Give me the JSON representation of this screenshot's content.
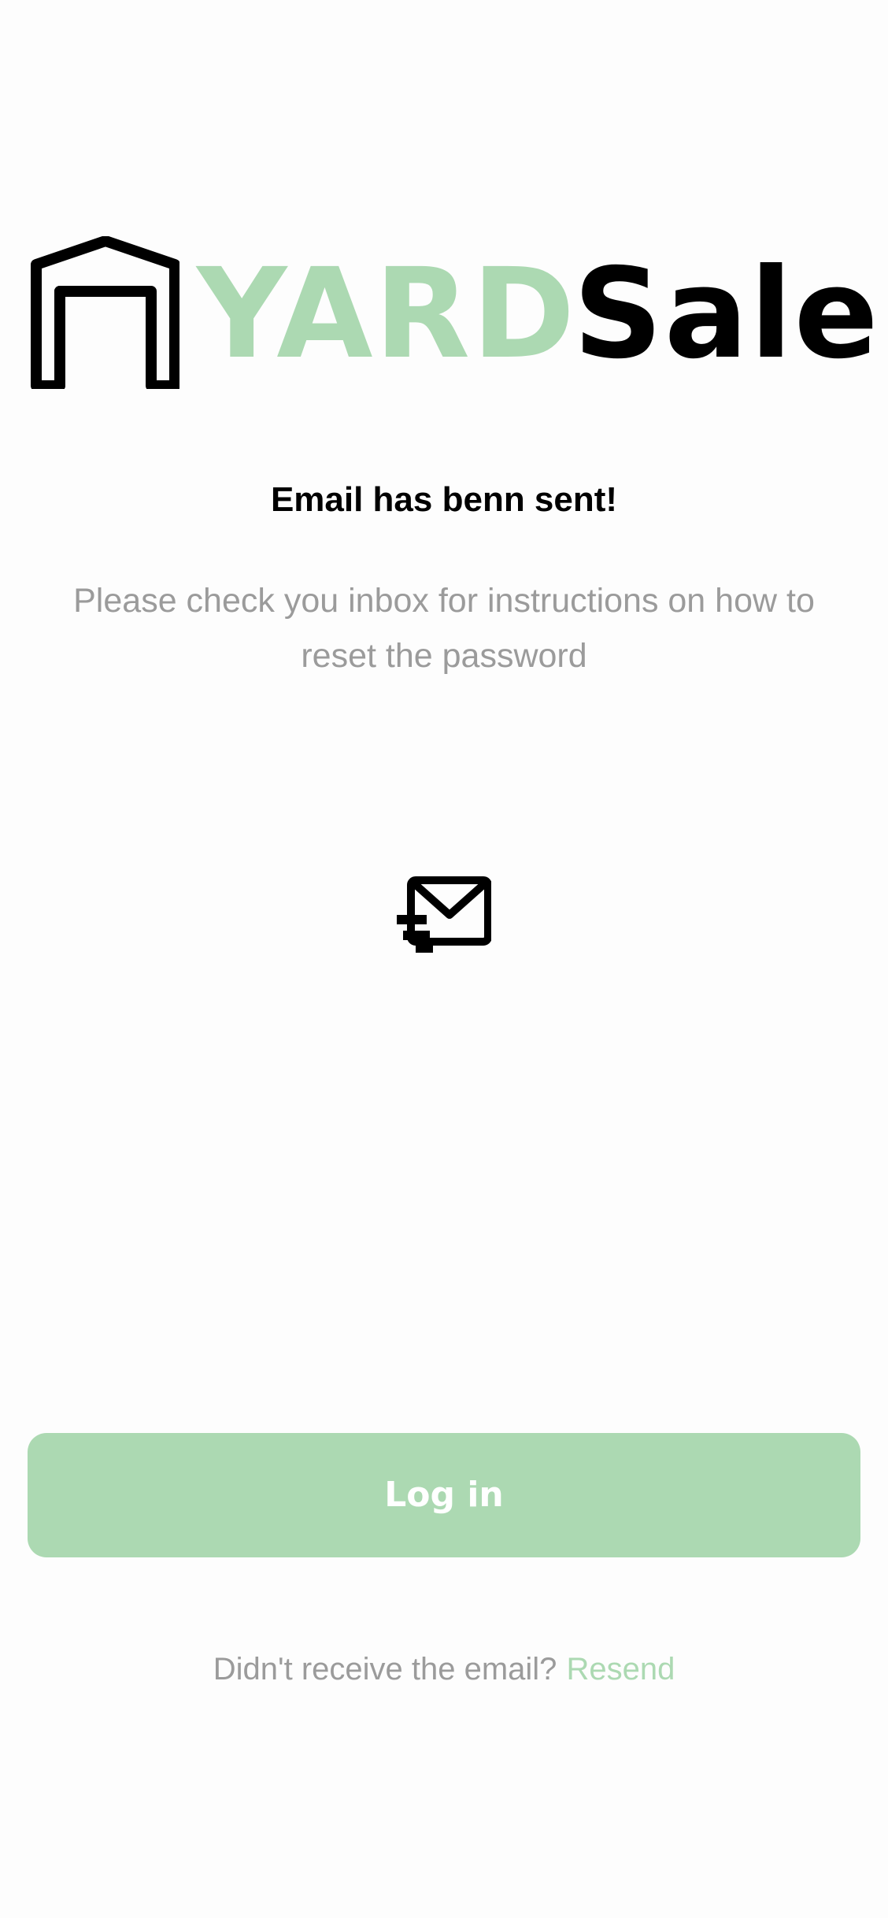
{
  "brand": {
    "word_yard": "YARD",
    "word_sale": "Sale",
    "icon": "garage-house-icon",
    "colors": {
      "accent": "#acd9b2",
      "primary_text": "#000000",
      "muted_text": "#9b9b9b",
      "background": "#fdfdfd"
    }
  },
  "message": {
    "title": "Email has benn sent!",
    "body": "Please check you inbox for instructions on how to reset the password",
    "icon": "email-sent-icon"
  },
  "actions": {
    "login_label": "Log in",
    "resend_prompt": "Didn't receive the email?",
    "resend_label": "Resend"
  }
}
